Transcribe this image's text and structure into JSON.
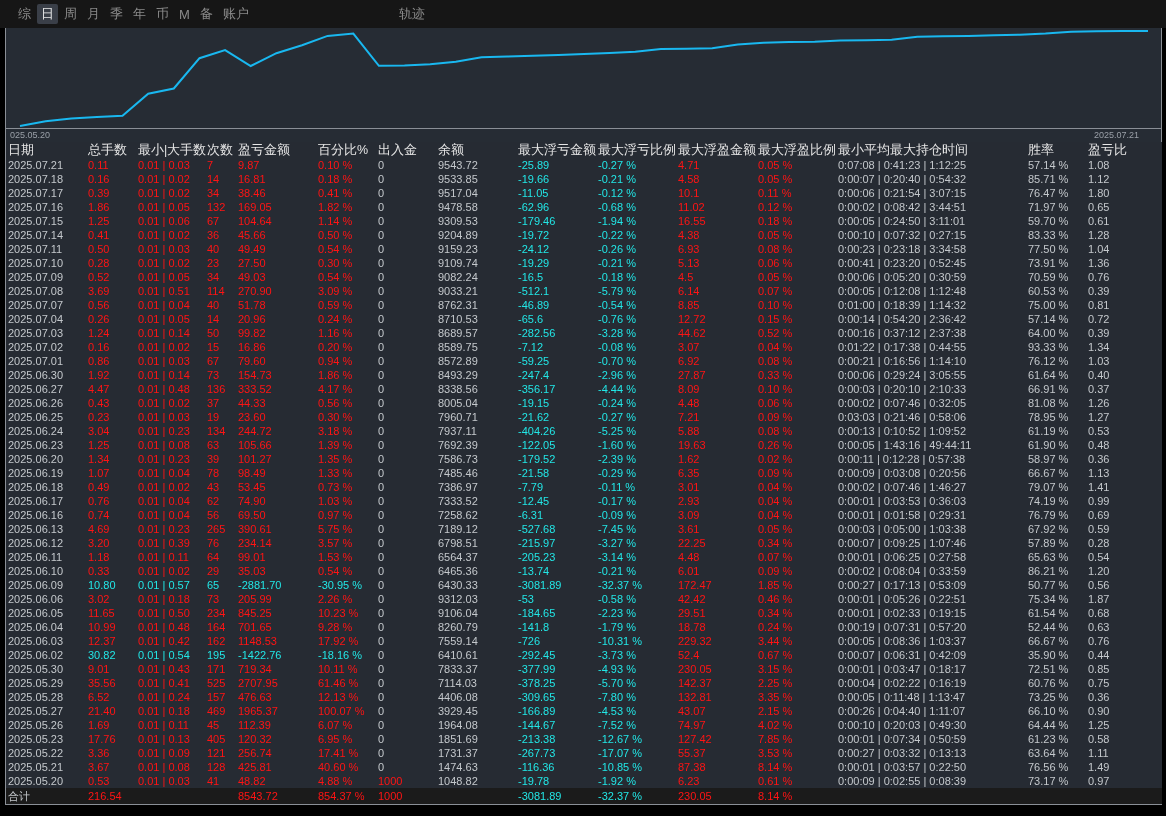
{
  "tabs": [
    {
      "label": "综",
      "selected": false
    },
    {
      "label": "日",
      "selected": true
    },
    {
      "label": "周",
      "selected": false
    },
    {
      "label": "月",
      "selected": false
    },
    {
      "label": "季",
      "selected": false
    },
    {
      "label": "年",
      "selected": false
    },
    {
      "label": "币",
      "selected": false
    },
    {
      "label": "M",
      "selected": false
    },
    {
      "label": "备",
      "selected": false
    },
    {
      "label": "账户",
      "selected": false
    }
  ],
  "trail_tab": {
    "label": "轨迹",
    "selected": false
  },
  "chart": {
    "start_label": "025.05.20",
    "end_label": "2025.07.21"
  },
  "table": {
    "columns": [
      "日期",
      "总手数",
      "最小|大手数",
      "次数",
      "盈亏金额",
      "百分比%",
      "出入金",
      "余额",
      "最大浮亏金额",
      "最大浮亏比例",
      "最大浮盈金额",
      "最大浮盈比例",
      "最小平均最大持仓时间",
      "胜率",
      "盈亏比"
    ],
    "rows": [
      {
        "loss": false,
        "deposit_marked": false,
        "cells": [
          "2025.07.21",
          "0.11",
          "0.01 | 0.03",
          "7",
          "9.87",
          "0.10 %",
          "0",
          "9543.72",
          "-25.89",
          "-0.27 %",
          "4.71",
          "0.05 %",
          "0:07:08 | 0:41:23 | 1:12:25",
          "57.14 %",
          "1.08"
        ]
      },
      {
        "loss": false,
        "deposit_marked": false,
        "cells": [
          "2025.07.18",
          "0.16",
          "0.01 | 0.02",
          "14",
          "16.81",
          "0.18 %",
          "0",
          "9533.85",
          "-19.66",
          "-0.21 %",
          "4.58",
          "0.05 %",
          "0:00:07 | 0:20:40 | 0:54:32",
          "85.71 %",
          "1.12"
        ]
      },
      {
        "loss": false,
        "deposit_marked": false,
        "cells": [
          "2025.07.17",
          "0.39",
          "0.01 | 0.02",
          "34",
          "38.46",
          "0.41 %",
          "0",
          "9517.04",
          "-11.05",
          "-0.12 %",
          "10.1",
          "0.11 %",
          "0:00:06 | 0:21:54 | 3:07:15",
          "76.47 %",
          "1.80"
        ]
      },
      {
        "loss": false,
        "deposit_marked": false,
        "cells": [
          "2025.07.16",
          "1.86",
          "0.01 | 0.05",
          "132",
          "169.05",
          "1.82 %",
          "0",
          "9478.58",
          "-62.96",
          "-0.68 %",
          "11.02",
          "0.12 %",
          "0:00:02 | 0:08:42 | 3:44:51",
          "71.97 %",
          "0.65"
        ]
      },
      {
        "loss": false,
        "deposit_marked": false,
        "cells": [
          "2025.07.15",
          "1.25",
          "0.01 | 0.06",
          "67",
          "104.64",
          "1.14 %",
          "0",
          "9309.53",
          "-179.46",
          "-1.94 %",
          "16.55",
          "0.18 %",
          "0:00:05 | 0:24:50 | 3:11:01",
          "59.70 %",
          "0.61"
        ]
      },
      {
        "loss": false,
        "deposit_marked": false,
        "cells": [
          "2025.07.14",
          "0.41",
          "0.01 | 0.02",
          "36",
          "45.66",
          "0.50 %",
          "0",
          "9204.89",
          "-19.72",
          "-0.22 %",
          "4.38",
          "0.05 %",
          "0:00:10 | 0:07:32 | 0:27:15",
          "83.33 %",
          "1.28"
        ]
      },
      {
        "loss": false,
        "deposit_marked": false,
        "cells": [
          "2025.07.11",
          "0.50",
          "0.01 | 0.03",
          "40",
          "49.49",
          "0.54 %",
          "0",
          "9159.23",
          "-24.12",
          "-0.26 %",
          "6.93",
          "0.08 %",
          "0:00:23 | 0:23:18 | 3:34:58",
          "77.50 %",
          "1.04"
        ]
      },
      {
        "loss": false,
        "deposit_marked": false,
        "cells": [
          "2025.07.10",
          "0.28",
          "0.01 | 0.02",
          "23",
          "27.50",
          "0.30 %",
          "0",
          "9109.74",
          "-19.29",
          "-0.21 %",
          "5.13",
          "0.06 %",
          "0:00:41 | 0:23:20 | 0:52:45",
          "73.91 %",
          "1.36"
        ]
      },
      {
        "loss": false,
        "deposit_marked": false,
        "cells": [
          "2025.07.09",
          "0.52",
          "0.01 | 0.05",
          "34",
          "49.03",
          "0.54 %",
          "0",
          "9082.24",
          "-16.5",
          "-0.18 %",
          "4.5",
          "0.05 %",
          "0:00:06 | 0:05:20 | 0:30:59",
          "70.59 %",
          "0.76"
        ]
      },
      {
        "loss": false,
        "deposit_marked": false,
        "cells": [
          "2025.07.08",
          "3.69",
          "0.01 | 0.51",
          "114",
          "270.90",
          "3.09 %",
          "0",
          "9033.21",
          "-512.1",
          "-5.79 %",
          "6.14",
          "0.07 %",
          "0:00:05 | 0:12:08 | 1:12:48",
          "60.53 %",
          "0.39"
        ]
      },
      {
        "loss": false,
        "deposit_marked": false,
        "cells": [
          "2025.07.07",
          "0.56",
          "0.01 | 0.04",
          "40",
          "51.78",
          "0.59 %",
          "0",
          "8762.31",
          "-46.89",
          "-0.54 %",
          "8.85",
          "0.10 %",
          "0:01:00 | 0:18:39 | 1:14:32",
          "75.00 %",
          "0.81"
        ]
      },
      {
        "loss": false,
        "deposit_marked": false,
        "cells": [
          "2025.07.04",
          "0.26",
          "0.01 | 0.05",
          "14",
          "20.96",
          "0.24 %",
          "0",
          "8710.53",
          "-65.6",
          "-0.76 %",
          "12.72",
          "0.15 %",
          "0:00:14 | 0:54:20 | 2:36:42",
          "57.14 %",
          "0.72"
        ]
      },
      {
        "loss": false,
        "deposit_marked": false,
        "cells": [
          "2025.07.03",
          "1.24",
          "0.01 | 0.14",
          "50",
          "99.82",
          "1.16 %",
          "0",
          "8689.57",
          "-282.56",
          "-3.28 %",
          "44.62",
          "0.52 %",
          "0:00:16 | 0:37:12 | 2:37:38",
          "64.00 %",
          "0.39"
        ]
      },
      {
        "loss": false,
        "deposit_marked": false,
        "cells": [
          "2025.07.02",
          "0.16",
          "0.01 | 0.02",
          "15",
          "16.86",
          "0.20 %",
          "0",
          "8589.75",
          "-7.12",
          "-0.08 %",
          "3.07",
          "0.04 %",
          "0:01:22 | 0:17:38 | 0:44:55",
          "93.33 %",
          "1.34"
        ]
      },
      {
        "loss": false,
        "deposit_marked": false,
        "cells": [
          "2025.07.01",
          "0.86",
          "0.01 | 0.03",
          "67",
          "79.60",
          "0.94 %",
          "0",
          "8572.89",
          "-59.25",
          "-0.70 %",
          "6.92",
          "0.08 %",
          "0:00:21 | 0:16:56 | 1:14:10",
          "76.12 %",
          "1.03"
        ]
      },
      {
        "loss": false,
        "deposit_marked": false,
        "cells": [
          "2025.06.30",
          "1.92",
          "0.01 | 0.14",
          "73",
          "154.73",
          "1.86 %",
          "0",
          "8493.29",
          "-247.4",
          "-2.96 %",
          "27.87",
          "0.33 %",
          "0:00:06 | 0:29:24 | 3:05:55",
          "61.64 %",
          "0.40"
        ]
      },
      {
        "loss": false,
        "deposit_marked": false,
        "cells": [
          "2025.06.27",
          "4.47",
          "0.01 | 0.48",
          "136",
          "333.52",
          "4.17 %",
          "0",
          "8338.56",
          "-356.17",
          "-4.44 %",
          "8.09",
          "0.10 %",
          "0:00:03 | 0:20:10 | 2:10:33",
          "66.91 %",
          "0.37"
        ]
      },
      {
        "loss": false,
        "deposit_marked": false,
        "cells": [
          "2025.06.26",
          "0.43",
          "0.01 | 0.02",
          "37",
          "44.33",
          "0.56 %",
          "0",
          "8005.04",
          "-19.15",
          "-0.24 %",
          "4.48",
          "0.06 %",
          "0:00:02 | 0:07:46 | 0:32:05",
          "81.08 %",
          "1.26"
        ]
      },
      {
        "loss": false,
        "deposit_marked": false,
        "cells": [
          "2025.06.25",
          "0.23",
          "0.01 | 0.03",
          "19",
          "23.60",
          "0.30 %",
          "0",
          "7960.71",
          "-21.62",
          "-0.27 %",
          "7.21",
          "0.09 %",
          "0:03:03 | 0:21:46 | 0:58:06",
          "78.95 %",
          "1.27"
        ]
      },
      {
        "loss": false,
        "deposit_marked": false,
        "cells": [
          "2025.06.24",
          "3.04",
          "0.01 | 0.23",
          "134",
          "244.72",
          "3.18 %",
          "0",
          "7937.11",
          "-404.26",
          "-5.25 %",
          "5.88",
          "0.08 %",
          "0:00:13 | 0:10:52 | 1:09:52",
          "61.19 %",
          "0.53"
        ]
      },
      {
        "loss": false,
        "deposit_marked": false,
        "cells": [
          "2025.06.23",
          "1.25",
          "0.01 | 0.08",
          "63",
          "105.66",
          "1.39 %",
          "0",
          "7692.39",
          "-122.05",
          "-1.60 %",
          "19.63",
          "0.26 %",
          "0:00:05 | 1:43:16 | 49:44:11",
          "61.90 %",
          "0.48"
        ]
      },
      {
        "loss": false,
        "deposit_marked": false,
        "cells": [
          "2025.06.20",
          "1.34",
          "0.01 | 0.23",
          "39",
          "101.27",
          "1.35 %",
          "0",
          "7586.73",
          "-179.52",
          "-2.39 %",
          "1.62",
          "0.02 %",
          "0:00:11 | 0:12:28 | 0:57:38",
          "58.97 %",
          "0.36"
        ]
      },
      {
        "loss": false,
        "deposit_marked": false,
        "cells": [
          "2025.06.19",
          "1.07",
          "0.01 | 0.04",
          "78",
          "98.49",
          "1.33 %",
          "0",
          "7485.46",
          "-21.58",
          "-0.29 %",
          "6.35",
          "0.09 %",
          "0:00:09 | 0:03:08 | 0:20:56",
          "66.67 %",
          "1.13"
        ]
      },
      {
        "loss": false,
        "deposit_marked": false,
        "cells": [
          "2025.06.18",
          "0.49",
          "0.01 | 0.02",
          "43",
          "53.45",
          "0.73 %",
          "0",
          "7386.97",
          "-7.79",
          "-0.11 %",
          "3.01",
          "0.04 %",
          "0:00:02 | 0:07:46 | 1:46:27",
          "79.07 %",
          "1.41"
        ]
      },
      {
        "loss": false,
        "deposit_marked": false,
        "cells": [
          "2025.06.17",
          "0.76",
          "0.01 | 0.04",
          "62",
          "74.90",
          "1.03 %",
          "0",
          "7333.52",
          "-12.45",
          "-0.17 %",
          "2.93",
          "0.04 %",
          "0:00:01 | 0:03:53 | 0:36:03",
          "74.19 %",
          "0.99"
        ]
      },
      {
        "loss": false,
        "deposit_marked": false,
        "cells": [
          "2025.06.16",
          "0.74",
          "0.01 | 0.04",
          "56",
          "69.50",
          "0.97 %",
          "0",
          "7258.62",
          "-6.31",
          "-0.09 %",
          "3.09",
          "0.04 %",
          "0:00:01 | 0:01:58 | 0:29:31",
          "76.79 %",
          "0.69"
        ]
      },
      {
        "loss": false,
        "deposit_marked": false,
        "cells": [
          "2025.06.13",
          "4.69",
          "0.01 | 0.23",
          "265",
          "390.61",
          "5.75 %",
          "0",
          "7189.12",
          "-527.68",
          "-7.45 %",
          "3.61",
          "0.05 %",
          "0:00:03 | 0:05:00 | 1:03:38",
          "67.92 %",
          "0.59"
        ]
      },
      {
        "loss": false,
        "deposit_marked": false,
        "cells": [
          "2025.06.12",
          "3.20",
          "0.01 | 0.39",
          "76",
          "234.14",
          "3.57 %",
          "0",
          "6798.51",
          "-215.97",
          "-3.27 %",
          "22.25",
          "0.34 %",
          "0:00:07 | 0:09:25 | 1:07:46",
          "57.89 %",
          "0.28"
        ]
      },
      {
        "loss": false,
        "deposit_marked": false,
        "cells": [
          "2025.06.11",
          "1.18",
          "0.01 | 0.11",
          "64",
          "99.01",
          "1.53 %",
          "0",
          "6564.37",
          "-205.23",
          "-3.14 %",
          "4.48",
          "0.07 %",
          "0:00:01 | 0:06:25 | 0:27:58",
          "65.63 %",
          "0.54"
        ]
      },
      {
        "loss": false,
        "deposit_marked": false,
        "cells": [
          "2025.06.10",
          "0.33",
          "0.01 | 0.02",
          "29",
          "35.03",
          "0.54 %",
          "0",
          "6465.36",
          "-13.74",
          "-0.21 %",
          "6.01",
          "0.09 %",
          "0:00:02 | 0:08:04 | 0:33:59",
          "86.21 %",
          "1.20"
        ]
      },
      {
        "loss": true,
        "deposit_marked": false,
        "cells": [
          "2025.06.09",
          "10.80",
          "0.01 | 0.57",
          "65",
          "-2881.70",
          "-30.95 %",
          "0",
          "6430.33",
          "-3081.89",
          "-32.37 %",
          "172.47",
          "1.85 %",
          "0:00:27 | 0:17:13 | 0:53:09",
          "50.77 %",
          "0.56"
        ]
      },
      {
        "loss": false,
        "deposit_marked": false,
        "cells": [
          "2025.06.06",
          "3.02",
          "0.01 | 0.18",
          "73",
          "205.99",
          "2.26 %",
          "0",
          "9312.03",
          "-53",
          "-0.58 %",
          "42.42",
          "0.46 %",
          "0:00:01 | 0:05:26 | 0:22:51",
          "75.34 %",
          "1.87"
        ]
      },
      {
        "loss": false,
        "deposit_marked": false,
        "cells": [
          "2025.06.05",
          "11.65",
          "0.01 | 0.50",
          "234",
          "845.25",
          "10.23 %",
          "0",
          "9106.04",
          "-184.65",
          "-2.23 %",
          "29.51",
          "0.34 %",
          "0:00:01 | 0:02:33 | 0:19:15",
          "61.54 %",
          "0.68"
        ]
      },
      {
        "loss": false,
        "deposit_marked": false,
        "cells": [
          "2025.06.04",
          "10.99",
          "0.01 | 0.48",
          "164",
          "701.65",
          "9.28 %",
          "0",
          "8260.79",
          "-141.8",
          "-1.79 %",
          "18.78",
          "0.24 %",
          "0:00:19 | 0:07:31 | 0:57:20",
          "52.44 %",
          "0.63"
        ]
      },
      {
        "loss": false,
        "deposit_marked": false,
        "cells": [
          "2025.06.03",
          "12.37",
          "0.01 | 0.42",
          "162",
          "1148.53",
          "17.92 %",
          "0",
          "7559.14",
          "-726",
          "-10.31 %",
          "229.32",
          "3.44 %",
          "0:00:05 | 0:08:36 | 1:03:37",
          "66.67 %",
          "0.76"
        ]
      },
      {
        "loss": true,
        "deposit_marked": false,
        "cells": [
          "2025.06.02",
          "30.82",
          "0.01 | 0.54",
          "195",
          "-1422.76",
          "-18.16 %",
          "0",
          "6410.61",
          "-292.45",
          "-3.73 %",
          "52.4",
          "0.67 %",
          "0:00:07 | 0:06:31 | 0:42:09",
          "35.90 %",
          "0.44"
        ]
      },
      {
        "loss": false,
        "deposit_marked": false,
        "cells": [
          "2025.05.30",
          "9.01",
          "0.01 | 0.43",
          "171",
          "719.34",
          "10.11 %",
          "0",
          "7833.37",
          "-377.99",
          "-4.93 %",
          "230.05",
          "3.15 %",
          "0:00:01 | 0:03:47 | 0:18:17",
          "72.51 %",
          "0.85"
        ]
      },
      {
        "loss": false,
        "deposit_marked": false,
        "cells": [
          "2025.05.29",
          "35.56",
          "0.01 | 0.41",
          "525",
          "2707.95",
          "61.46 %",
          "0",
          "7114.03",
          "-378.25",
          "-5.70 %",
          "142.37",
          "2.25 %",
          "0:00:04 | 0:02:22 | 0:16:19",
          "60.76 %",
          "0.75"
        ]
      },
      {
        "loss": false,
        "deposit_marked": false,
        "cells": [
          "2025.05.28",
          "6.52",
          "0.01 | 0.24",
          "157",
          "476.63",
          "12.13 %",
          "0",
          "4406.08",
          "-309.65",
          "-7.80 %",
          "132.81",
          "3.35 %",
          "0:00:05 | 0:11:48 | 1:13:47",
          "73.25 %",
          "0.36"
        ]
      },
      {
        "loss": false,
        "deposit_marked": false,
        "cells": [
          "2025.05.27",
          "21.40",
          "0.01 | 0.18",
          "469",
          "1965.37",
          "100.07 %",
          "0",
          "3929.45",
          "-166.89",
          "-4.53 %",
          "43.07",
          "2.15 %",
          "0:00:26 | 0:04:40 | 1:11:07",
          "66.10 %",
          "0.90"
        ]
      },
      {
        "loss": false,
        "deposit_marked": false,
        "cells": [
          "2025.05.26",
          "1.69",
          "0.01 | 0.11",
          "45",
          "112.39",
          "6.07 %",
          "0",
          "1964.08",
          "-144.67",
          "-7.52 %",
          "74.97",
          "4.02 %",
          "0:00:10 | 0:20:03 | 0:49:30",
          "64.44 %",
          "1.25"
        ]
      },
      {
        "loss": false,
        "deposit_marked": false,
        "cells": [
          "2025.05.23",
          "17.76",
          "0.01 | 0.13",
          "405",
          "120.32",
          "6.95 %",
          "0",
          "1851.69",
          "-213.38",
          "-12.67 %",
          "127.42",
          "7.85 %",
          "0:00:01 | 0:07:34 | 0:50:59",
          "61.23 %",
          "0.58"
        ]
      },
      {
        "loss": false,
        "deposit_marked": false,
        "cells": [
          "2025.05.22",
          "3.36",
          "0.01 | 0.09",
          "121",
          "256.74",
          "17.41 %",
          "0",
          "1731.37",
          "-267.73",
          "-17.07 %",
          "55.37",
          "3.53 %",
          "0:00:27 | 0:03:32 | 0:13:13",
          "63.64 %",
          "1.11"
        ]
      },
      {
        "loss": false,
        "deposit_marked": false,
        "cells": [
          "2025.05.21",
          "3.67",
          "0.01 | 0.08",
          "128",
          "425.81",
          "40.60 %",
          "0",
          "1474.63",
          "-116.36",
          "-10.85 %",
          "87.38",
          "8.14 %",
          "0:00:01 | 0:03:57 | 0:22:50",
          "76.56 %",
          "1.49"
        ]
      },
      {
        "loss": false,
        "deposit_marked": true,
        "cells": [
          "2025.05.20",
          "0.53",
          "0.01 | 0.03",
          "41",
          "48.82",
          "4.88 %",
          "1000",
          "1048.82",
          "-19.78",
          "-1.92 %",
          "6.23",
          "0.61 %",
          "0:00:09 | 0:02:55 | 0:08:39",
          "73.17 %",
          "0.97"
        ]
      }
    ],
    "total": {
      "label": "合计",
      "lots": "216.54",
      "pnl": "8543.72",
      "pct": "854.37 %",
      "deposit": "1000",
      "max_float_loss": "-3081.89",
      "max_float_loss_pct": "-32.37 %",
      "max_float_profit": "230.05",
      "max_float_profit_pct": "8.14 %"
    }
  }
}
